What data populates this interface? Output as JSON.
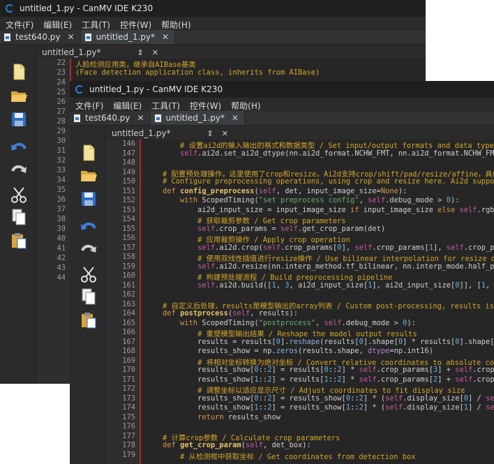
{
  "window_title": "untitled_1.py - CanMV IDE K230",
  "menu": [
    "文件(F)",
    "编辑(E)",
    "工具(T)",
    "控件(W)",
    "帮助(H)"
  ],
  "tabs": [
    {
      "label": "test640.py",
      "close": "✕"
    },
    {
      "label": "untitled_1.py*",
      "close": "✕"
    }
  ],
  "editor_tab": {
    "label": "untitled_1.py*",
    "close": "✕"
  },
  "toolbar_icons": [
    "new-file-icon",
    "open-folder-icon",
    "save-icon",
    "undo-icon",
    "redo-icon",
    "cut-icon",
    "copy-icon",
    "paste-icon"
  ],
  "back_editor": {
    "line_numbers": [
      "22",
      "23",
      "24",
      "25",
      "26",
      "27",
      "28",
      "29",
      "30",
      "31",
      "32",
      "33",
      "34",
      "35",
      "36",
      "37",
      "38",
      "39",
      "40",
      "41",
      "42",
      "43",
      "44"
    ],
    "line_22": "人脸检测应用类，继承自AIBase基类",
    "line_23": "(Face detection application class, inherits from AIBase)"
  },
  "front_editor": {
    "line_numbers": [
      "146",
      "147",
      "148",
      "149",
      "150",
      "151",
      "152",
      "153",
      "154",
      "155",
      "156",
      "157",
      "158",
      "159",
      "160",
      "161",
      "162",
      "163",
      "164",
      "165",
      "166",
      "167",
      "168",
      "169",
      "170",
      "171",
      "172",
      "173",
      "174",
      "175",
      "176",
      "177",
      "178",
      "179"
    ]
  },
  "colors": {
    "background": "#262626",
    "gutter_marker": "#b3262e",
    "comment": "#d4a52a",
    "keyword": "#d89643",
    "string": "#6aab73"
  }
}
